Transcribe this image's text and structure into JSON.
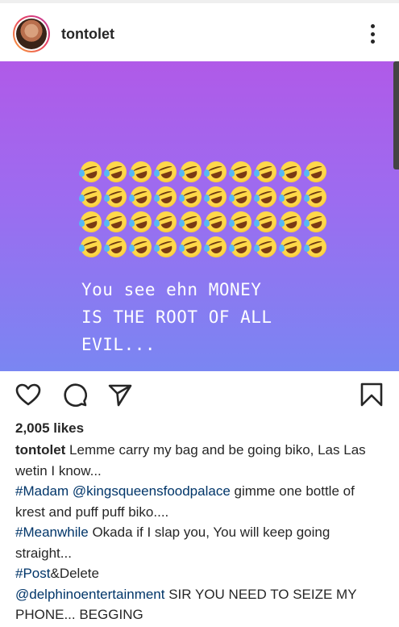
{
  "post": {
    "username": "tontolet",
    "media_text": "You see ehn MONEY\nIS THE ROOT OF ALL\nEVIL...",
    "emoji_name": "rolling-on-the-floor-laughing",
    "emoji_rows": [
      10,
      10,
      10,
      10
    ],
    "likes": "2,005 likes",
    "caption": {
      "author": "tontolet",
      "p1": " Lemme carry my bag and be going biko, Las Las wetin I know...",
      "p2_tag": "#Madam",
      "p2_mention": "@kingsqueensfoodpalace",
      "p2_text": " gimme one bottle of krest and puff puff biko....",
      "p3_tag": "#Meanwhile",
      "p3_text": " Okada if I slap you, You will keep going straight...",
      "p4_tag": "#Post",
      "p4_text": "&Delete",
      "p5_mention": "@delphinoentertainment",
      "p5_text": " SIR YOU NEED TO SEIZE MY PHONE... BEGGING"
    }
  },
  "icons": {
    "like": "heart-icon",
    "comment": "comment-icon",
    "share": "send-icon",
    "save": "bookmark-icon",
    "more": "more-vertical-icon"
  },
  "colors": {
    "gradient_top": "#b05ae8",
    "gradient_bottom": "#7a86f2",
    "link": "#003569"
  }
}
